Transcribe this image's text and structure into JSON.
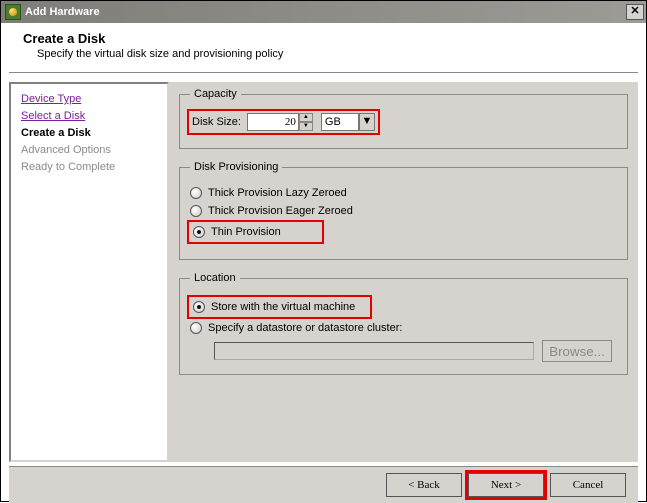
{
  "window": {
    "title": "Add Hardware"
  },
  "header": {
    "title": "Create a Disk",
    "subtitle": "Specify the virtual disk size and provisioning policy"
  },
  "sidebar": {
    "steps": [
      {
        "label": "Device Type",
        "state": "visited"
      },
      {
        "label": "Select a Disk",
        "state": "visited"
      },
      {
        "label": "Create a Disk",
        "state": "current"
      },
      {
        "label": "Advanced Options",
        "state": "pending"
      },
      {
        "label": "Ready to Complete",
        "state": "pending"
      }
    ]
  },
  "capacity": {
    "legend": "Capacity",
    "disk_size_label": "Disk Size:",
    "disk_size_value": "20",
    "unit_value": "GB"
  },
  "provisioning": {
    "legend": "Disk Provisioning",
    "options": [
      {
        "label": "Thick Provision Lazy Zeroed",
        "selected": false
      },
      {
        "label": "Thick Provision Eager Zeroed",
        "selected": false
      },
      {
        "label": "Thin Provision",
        "selected": true
      }
    ]
  },
  "location": {
    "legend": "Location",
    "options": [
      {
        "label": "Store with the virtual machine",
        "selected": true
      },
      {
        "label": "Specify a datastore or datastore cluster:",
        "selected": false
      }
    ],
    "datastore_value": "",
    "browse_label": "Browse..."
  },
  "footer": {
    "back": "< Back",
    "next": "Next >",
    "cancel": "Cancel"
  }
}
